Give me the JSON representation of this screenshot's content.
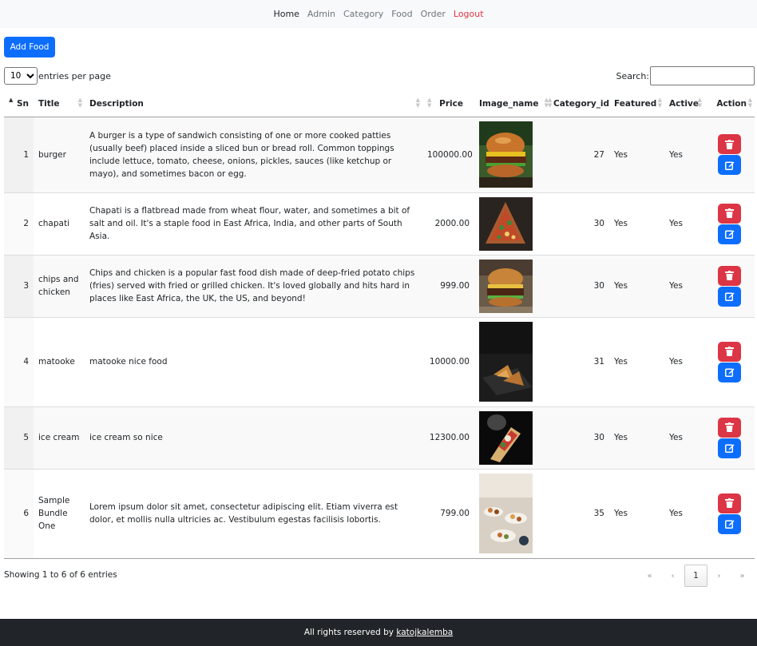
{
  "nav": {
    "items": [
      {
        "label": "Home",
        "active": true
      },
      {
        "label": "Admin"
      },
      {
        "label": "Category"
      },
      {
        "label": "Food"
      },
      {
        "label": "Order"
      },
      {
        "label": "Logout",
        "danger": true
      }
    ]
  },
  "toolbar": {
    "add_label": "Add Food",
    "length_value": "10",
    "length_suffix": "entries per page",
    "search_label": "Search:",
    "search_value": ""
  },
  "table": {
    "columns": [
      {
        "key": "sn",
        "label": "Sn"
      },
      {
        "key": "title",
        "label": "Title"
      },
      {
        "key": "description",
        "label": "Description"
      },
      {
        "key": "price",
        "label": "Price"
      },
      {
        "key": "image_name",
        "label": "Image_name"
      },
      {
        "key": "category_id",
        "label": "Category_id"
      },
      {
        "key": "featured",
        "label": "Featured"
      },
      {
        "key": "active",
        "label": "Active"
      },
      {
        "key": "action",
        "label": "Action"
      }
    ],
    "rows": [
      {
        "sn": "1",
        "title": "burger",
        "description": "A burger is a type of sandwich consisting of one or more cooked patties (usually beef) placed inside a sliced bun or bread roll. Common toppings include lettuce, tomato, cheese, onions, pickles, sauces (like ketchup or mayo), and sometimes bacon or egg.",
        "price": "100000.00",
        "image": "burger-photo",
        "category_id": "27",
        "featured": "Yes",
        "active": "Yes"
      },
      {
        "sn": "2",
        "title": "chapati",
        "description": "Chapati is a flatbread made from wheat flour, water, and sometimes a bit of salt and oil. It's a staple food in East Africa, India, and other parts of South Asia.",
        "price": "2000.00",
        "image": "pizza-photo",
        "category_id": "30",
        "featured": "Yes",
        "active": "Yes"
      },
      {
        "sn": "3",
        "title": "chips and chicken",
        "description": "Chips and chicken is a popular fast food dish made of deep-fried potato chips (fries) served with fried or grilled chicken. It's loved globally and hits hard in places like East Africa, the UK, the US, and beyond!",
        "price": "999.00",
        "image": "burger-photo-2",
        "category_id": "30",
        "featured": "Yes",
        "active": "Yes"
      },
      {
        "sn": "4",
        "title": "matooke",
        "description": "matooke nice food",
        "price": "10000.00",
        "image": "samosa-photo",
        "category_id": "31",
        "featured": "Yes",
        "active": "Yes"
      },
      {
        "sn": "5",
        "title": "ice cream",
        "description": "ice cream so nice",
        "price": "12300.00",
        "image": "dessert-photo",
        "category_id": "30",
        "featured": "Yes",
        "active": "Yes"
      },
      {
        "sn": "6",
        "title": "Sample Bundle One",
        "description": "Lorem ipsum dolor sit amet, consectetur adipiscing elit. Etiam viverra est dolor, et mollis nulla ultricies ac. Vestibulum egestas facilisis lobortis.",
        "price": "799.00",
        "image": "buffet-photo",
        "category_id": "35",
        "featured": "Yes",
        "active": "Yes"
      }
    ]
  },
  "info": "Showing 1 to 6 of 6 entries",
  "pager": {
    "first": "«",
    "prev": "‹",
    "current": "1",
    "next": "›",
    "last": "»"
  },
  "footer": {
    "text": "All rights reserved by",
    "link": "katojkalemba"
  },
  "colors": {
    "primary": "#0d6efd",
    "danger": "#dc3545",
    "footer": "#212529"
  }
}
